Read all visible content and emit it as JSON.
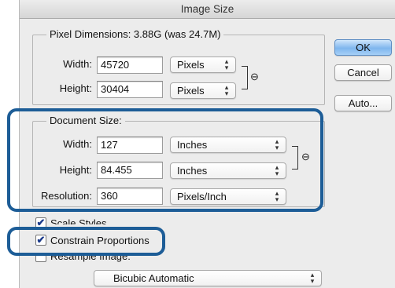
{
  "window": {
    "title": "Image Size"
  },
  "pixel_dimensions": {
    "legend": "Pixel Dimensions:  3.88G (was 24.7M)",
    "width_label": "Width:",
    "width_value": "45720",
    "width_unit": "Pixels",
    "height_label": "Height:",
    "height_value": "30404",
    "height_unit": "Pixels"
  },
  "document_size": {
    "legend": "Document Size:",
    "width_label": "Width:",
    "width_value": "127",
    "width_unit": "Inches",
    "height_label": "Height:",
    "height_value": "84.455",
    "height_unit": "Inches",
    "resolution_label": "Resolution:",
    "resolution_value": "360",
    "resolution_unit": "Pixels/Inch"
  },
  "buttons": {
    "ok": "OK",
    "cancel": "Cancel",
    "auto": "Auto..."
  },
  "options": {
    "scale_styles": {
      "label": "Scale Styles",
      "checked": true
    },
    "constrain_proportions": {
      "label": "Constrain Proportions",
      "checked": true
    },
    "resample_image": {
      "label": "Resample Image:",
      "checked": false
    },
    "resample_method": "Bicubic Automatic"
  },
  "icons": {
    "link": "link-icon",
    "checkmark": "✔",
    "select_arrows": "up-down-arrows"
  },
  "colors": {
    "highlight": "#1d5d97",
    "default_button": "#7fb6ee",
    "dialog_bg": "#ececec"
  }
}
